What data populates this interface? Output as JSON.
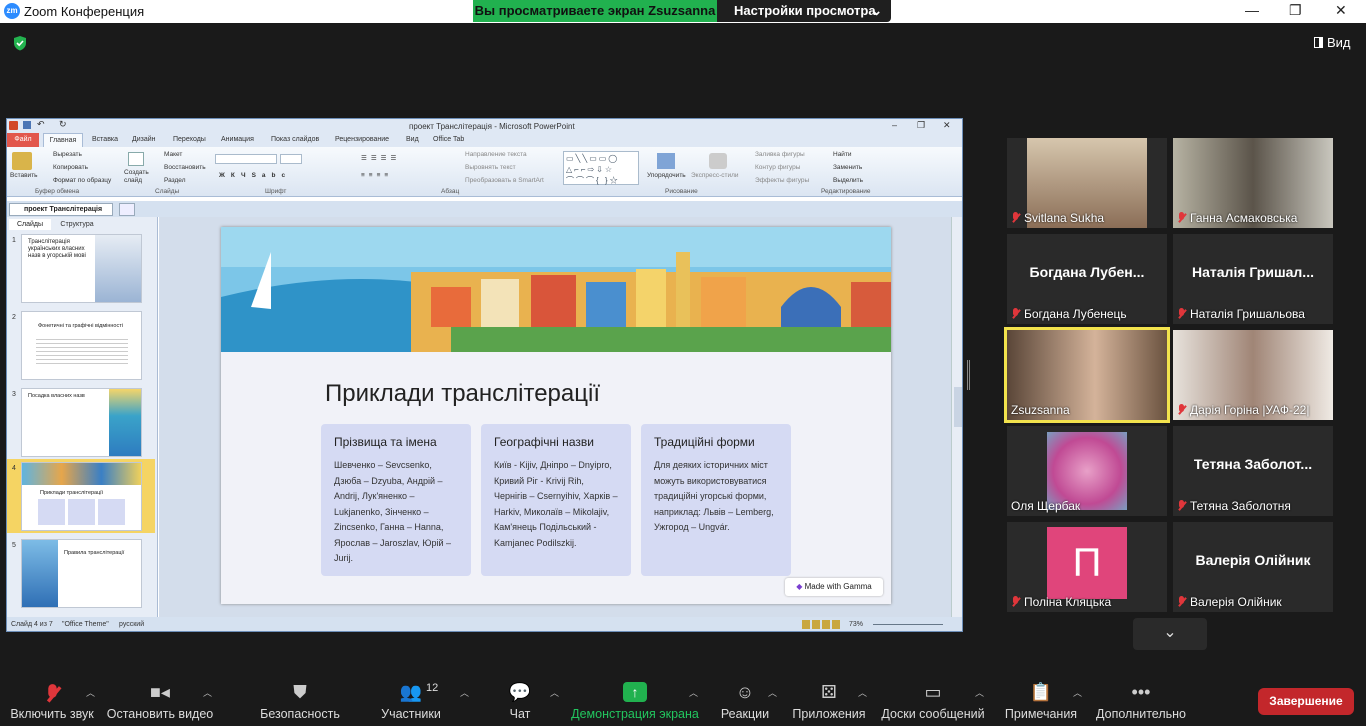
{
  "window": {
    "logo": "zm",
    "title": "Zoom Конференция",
    "minimize": "—",
    "maximize": "❐",
    "close": "✕"
  },
  "share_banner": {
    "status": "Вы просматриваете экран Zsuzsanna",
    "options": "Настройки просмотра"
  },
  "view_button": "Вид",
  "ppt": {
    "title": "проект Транслітерація - Microsoft PowerPoint",
    "file_tab": "Файл",
    "tabs": [
      "Главная",
      "Вставка",
      "Дизайн",
      "Переходы",
      "Анимация",
      "Показ слайдов",
      "Рецензирование",
      "Вид",
      "Office Tab"
    ],
    "ribbon": {
      "paste": "Вставить",
      "cut": "Вырезать",
      "copy": "Копировать",
      "format": "Формат по образцу",
      "new_slide": "Создать слайд",
      "layout": "Макет",
      "reset": "Восстановить",
      "section": "Раздел",
      "text_dir": "Направление текста",
      "align_text": "Выровнять текст",
      "smartart": "Преобразовать в SmartArt",
      "arrange": "Упорядочить",
      "quick_styles": "Экспресс-стили",
      "fill": "Заливка фигуры",
      "outline": "Контур фигуры",
      "effects": "Эффекты фигуры",
      "find": "Найти",
      "replace": "Заменить",
      "select": "Выделить",
      "groups": [
        "Буфер обмена",
        "Слайды",
        "Шрифт",
        "Абзац",
        "Рисование",
        "Редактирование"
      ]
    },
    "doc_tab": "проект Транслітерація",
    "pane_tabs": [
      "Слайды",
      "Структура"
    ],
    "thumbs": [
      {
        "num": "1",
        "title": "Транслітерація українських власних назв в угорській мові"
      },
      {
        "num": "2",
        "title": "Фонетичні та графічні відмінності"
      },
      {
        "num": "3",
        "title": "Посадка власних назв"
      },
      {
        "num": "4",
        "title": "Приклади транслітерації"
      },
      {
        "num": "5",
        "title": "Правила транслітерації"
      }
    ],
    "slide": {
      "heading": "Приклади транслітерації",
      "cards": [
        {
          "title": "Прізвища та імена",
          "body": "Шевченко – Sevcsenko, Дзюба – Dzyuba, Андрій – Andrij, Лук'яненко – Lukjanenko, Зінченко – Zincsenko, Ганна – Hanna, Ярослав – Jaroszlav, Юрій – Jurij."
        },
        {
          "title": "Географічні назви",
          "body": "Київ - Kijiv, Дніпро – Dnyipro, Кривий Ріг - Krivij Rih, Чернігів – Csernyihiv, Харків – Harkiv, Миколаїв – Mikolajiv, Кам'янець Подільський - Kamjanec Podilszkij."
        },
        {
          "title": "Традиційні форми",
          "body": "Для деяких історичних міст можуть використовуватися традиційні угорські форми, наприклад: Львів – Lemberg, Ужгород – Ungvár."
        }
      ],
      "gamma": "Made with Gamma"
    },
    "status": {
      "slide": "Слайд 4 из 7",
      "theme": "\"Office Theme\"",
      "lang": "русский",
      "zoom": "73%"
    }
  },
  "participants": [
    {
      "name": "Svitlana Sukha",
      "big": "",
      "muted": true
    },
    {
      "name": "Ганна Асмаковська",
      "big": "",
      "muted": true
    },
    {
      "name": "Богдана Лубенець",
      "big": "Богдана Лубен...",
      "muted": true
    },
    {
      "name": "Наталія Гришальова",
      "big": "Наталія Гришал...",
      "muted": true
    },
    {
      "name": "Zsuzsanna",
      "big": "",
      "muted": false
    },
    {
      "name": "Дарія Горіна |УАФ-22|",
      "big": "",
      "muted": true
    },
    {
      "name": "Оля Щербак",
      "big": "",
      "muted": false
    },
    {
      "name": "Тетяна Заболотня",
      "big": "Тетяна Заболот...",
      "muted": true
    },
    {
      "name": "Поліна Кляцька",
      "big": "П",
      "muted": true
    },
    {
      "name": "Валерія Олійник",
      "big": "Валерія Олійник",
      "muted": true
    }
  ],
  "toolbar": {
    "items": [
      {
        "label": "Включить звук",
        "icon": "mic-muted-icon"
      },
      {
        "label": "Остановить видео",
        "icon": "camera-icon"
      },
      {
        "label": "Безопасность",
        "icon": "shield-icon"
      },
      {
        "label": "Участники",
        "icon": "participants-icon",
        "count": "12"
      },
      {
        "label": "Чат",
        "icon": "chat-icon"
      },
      {
        "label": "Демонстрация экрана",
        "icon": "share-screen-icon"
      },
      {
        "label": "Реакции",
        "icon": "reactions-icon"
      },
      {
        "label": "Приложения",
        "icon": "apps-icon"
      },
      {
        "label": "Доски сообщений",
        "icon": "whiteboard-icon"
      },
      {
        "label": "Примечания",
        "icon": "notes-icon"
      },
      {
        "label": "Дополнительно",
        "icon": "more-icon"
      }
    ],
    "end": "Завершение"
  },
  "colors": {
    "zoom_blue": "#2d8cff",
    "share_green": "#21b14f",
    "end_red": "#c3272b",
    "active_speaker": "#f3e34d"
  }
}
